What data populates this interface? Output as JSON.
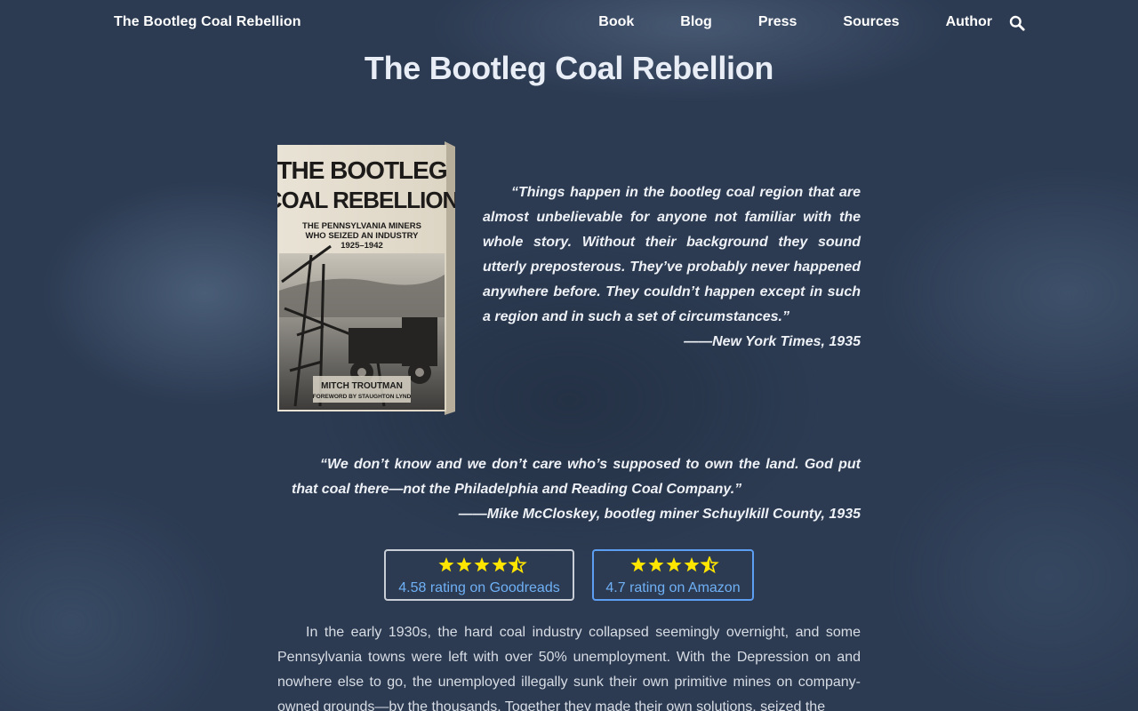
{
  "nav": {
    "brand": "The Bootleg Coal Rebellion",
    "links": [
      "Book",
      "Blog",
      "Press",
      "Sources",
      "Author"
    ]
  },
  "page": {
    "title": "The Bootleg Coal Rebellion"
  },
  "cover": {
    "title_line1": "THE BOOTLEG",
    "title_line2": "COAL REBELLION",
    "subtitle_line1": "THE PENNSYLVANIA MINERS",
    "subtitle_line2": "WHO SEIZED AN INDUSTRY",
    "subtitle_line3": "1925–1942",
    "author": "MITCH TROUTMAN",
    "foreword": "FOREWORD BY STAUGHTON LYND"
  },
  "quotes": [
    {
      "text": "“Things happen in the bootleg coal region that are almost unbelievable for anyone not familiar with the whole story. Without their background they sound utterly preposterous. They’ve probably never happened anywhere before. They couldn’t happen except in such a region and in such a set of circumstances.”",
      "cite": "——New York Times, 1935"
    },
    {
      "text": "“We don’t know and we don’t care who’s supposed to own the land. God put that coal there—not the Philadelphia and Reading Coal Company.”",
      "cite": "——Mike McCloskey, bootleg miner Schuylkill County, 1935"
    }
  ],
  "ratings": [
    {
      "label": "4.58 rating on Goodreads",
      "stars": 4.5
    },
    {
      "label": "4.7 rating on Amazon",
      "stars": 4.5
    }
  ],
  "intro": "In the early 1930s, the hard coal industry collapsed seemingly overnight, and some Pennsylvania towns were left with over 50% unemployment. With the Depression on and nowhere else to go, the unemployed illegally sunk their own primitive mines on company-owned grounds—by the thousands. Together they made their own solutions, seized the",
  "colors": {
    "background": "#2c3b52",
    "star": "#ffe500",
    "link": "#6fb0f5",
    "amazon_border": "#5c9ef2",
    "goodreads_border": "#c9ced6"
  }
}
